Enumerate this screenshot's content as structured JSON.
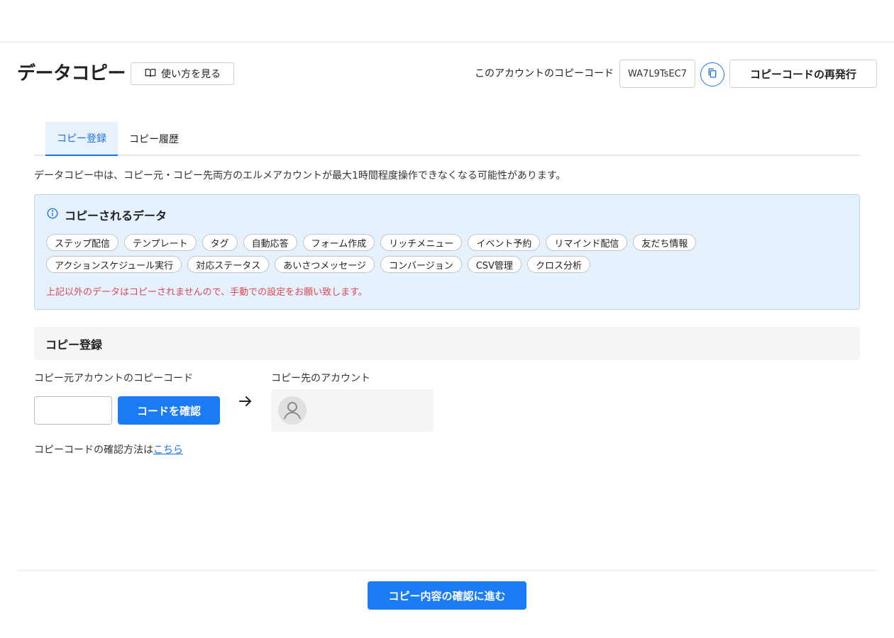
{
  "header": {
    "title": "データコピー",
    "howto_label": "使い方を見る",
    "code_label": "このアカウントのコピーコード",
    "code_value": "WA7L9TsEC7",
    "reissue_label": "コピーコードの再発行"
  },
  "tabs": [
    {
      "label": "コピー登録",
      "active": true
    },
    {
      "label": "コピー履歴",
      "active": false
    }
  ],
  "notice": "データコピー中は、コピー元・コピー先両方のエルメアカウントが最大1時間程度操作できなくなる可能性があります。",
  "info": {
    "title": "コピーされるデータ",
    "chips_row1": [
      "ステップ配信",
      "テンプレート",
      "タグ",
      "自動応答",
      "フォーム作成",
      "リッチメニュー",
      "イベント予約",
      "リマインド配信",
      "友だち情報"
    ],
    "chips_row2": [
      "アクションスケジュール実行",
      "対応ステータス",
      "あいさつメッセージ",
      "コンバージョン",
      "CSV管理",
      "クロス分析"
    ],
    "warning": "上記以外のデータはコピーされませんので、手動での設定をお願い致します。",
    "accent": "#1a73e8",
    "warning_color": "#e0464d"
  },
  "register": {
    "section_title": "コピー登録",
    "source_label": "コピー元アカウントのコピーコード",
    "source_value": "",
    "confirm_label": "コードを確認",
    "dest_label": "コピー先のアカウント",
    "help_prefix": "コピーコードの確認方法は",
    "help_link": "こちら"
  },
  "footer": {
    "proceed_label": "コピー内容の確認に進む"
  },
  "icons": [
    "book-icon",
    "copy-icon",
    "info-icon",
    "arrow-right-icon",
    "user-avatar-icon"
  ]
}
